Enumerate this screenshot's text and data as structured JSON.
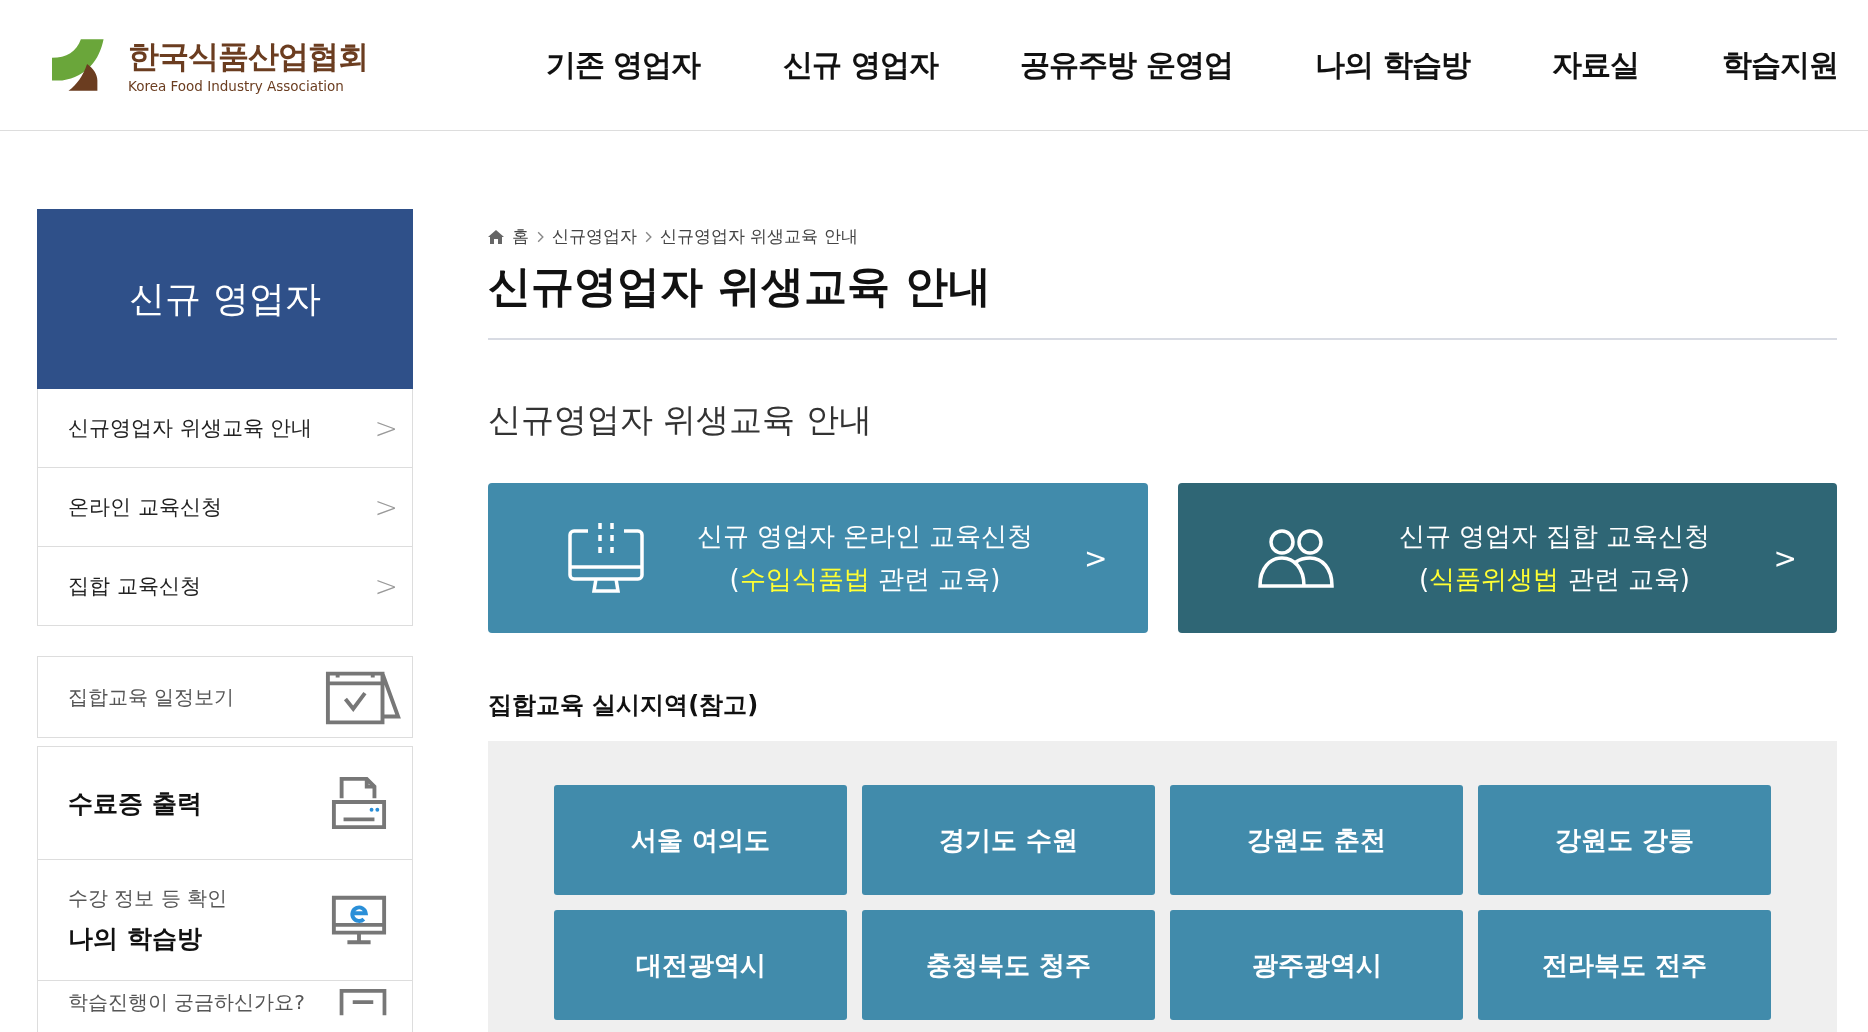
{
  "logo": {
    "name": "한국식품산업협회",
    "english": "Korea Food Industry Association"
  },
  "nav": [
    "기존 영업자",
    "신규 영업자",
    "공유주방 운영업",
    "나의 학습방",
    "자료실",
    "학습지원"
  ],
  "sidebar": {
    "title": "신규 영업자",
    "menu": [
      {
        "label": "신규영업자 위생교육 안내",
        "chevron": ">"
      },
      {
        "label": "온라인 교육신청",
        "chevron": ">"
      },
      {
        "label": "집합 교육신청",
        "chevron": ">"
      }
    ],
    "schedule": {
      "label": "집합교육 일정보기"
    },
    "certificate": {
      "label": "수료증 출력"
    },
    "my_room": {
      "caption": "수강 정보 등 확인",
      "label": "나의 학습방"
    },
    "help": {
      "caption": "학습진행이 궁금하신가요?"
    }
  },
  "breadcrumb": [
    "홈",
    "신규영업자",
    "신규영업자 위생교육 안내"
  ],
  "page_title": "신규영업자 위생교육 안내",
  "section_title": "신규영업자 위생교육 안내",
  "apply_cards": [
    {
      "kind": "online",
      "title": "신규 영업자 온라인 교육신청",
      "subtitle": [
        {
          "text": "(",
          "highlight": false
        },
        {
          "text": "수입식품법",
          "highlight": true
        },
        {
          "text": " 관련 교육)",
          "highlight": false
        }
      ],
      "arrow": ">"
    },
    {
      "kind": "group",
      "title": "신규 영업자 집합 교육신청",
      "subtitle": [
        {
          "text": "(",
          "highlight": false
        },
        {
          "text": "식품위생법",
          "highlight": true
        },
        {
          "text": " 관련 교육)",
          "highlight": false
        }
      ],
      "arrow": ">"
    }
  ],
  "regions_title": "집합교육 실시지역(참고)",
  "regions": [
    "서울 여의도",
    "경기도 수원",
    "강원도 춘천",
    "강원도 강릉",
    "대전광역시",
    "충청북도 청주",
    "광주광역시",
    "전라북도 전주"
  ]
}
